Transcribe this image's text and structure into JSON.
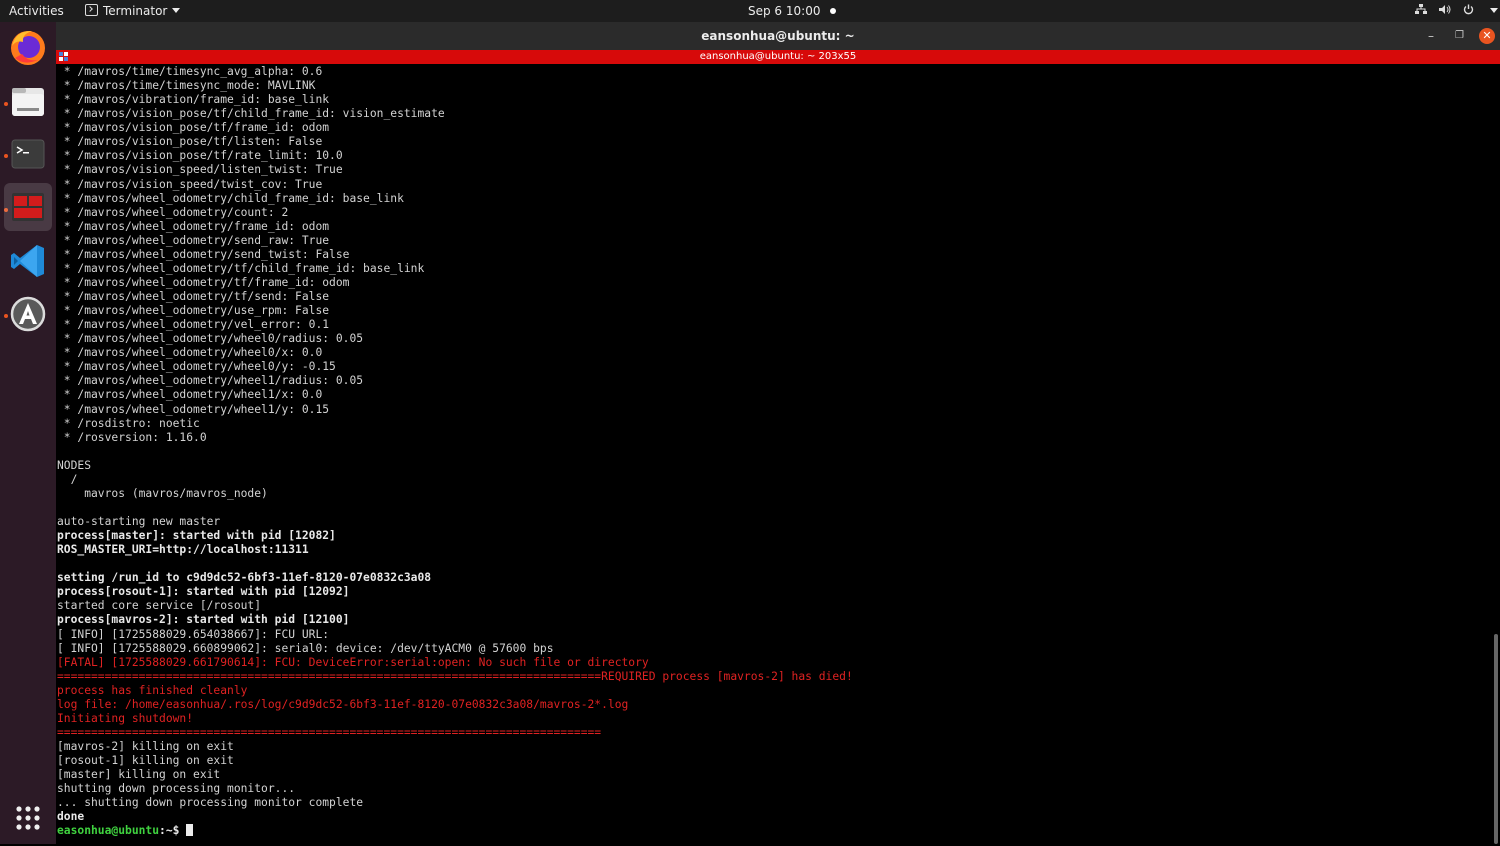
{
  "topbar": {
    "activities": "Activities",
    "app_name": "Terminator",
    "clock": "Sep 6  10:00"
  },
  "dock": {
    "items": [
      {
        "name": "firefox-icon"
      },
      {
        "name": "files-icon"
      },
      {
        "name": "terminal-icon"
      },
      {
        "name": "terminator-icon"
      },
      {
        "name": "vscode-icon"
      },
      {
        "name": "software-center-icon"
      },
      {
        "name": "show-apps-icon"
      }
    ]
  },
  "window": {
    "title": "eansonhua@ubuntu: ~",
    "terminal_title": "eansonhua@ubuntu: ~ 203x55"
  },
  "terminal": {
    "lines": [
      {
        "text": " * /mavros/time/timesync_avg_alpha: 0.6"
      },
      {
        "text": " * /mavros/time/timesync_mode: MAVLINK"
      },
      {
        "text": " * /mavros/vibration/frame_id: base_link"
      },
      {
        "text": " * /mavros/vision_pose/tf/child_frame_id: vision_estimate"
      },
      {
        "text": " * /mavros/vision_pose/tf/frame_id: odom"
      },
      {
        "text": " * /mavros/vision_pose/tf/listen: False"
      },
      {
        "text": " * /mavros/vision_pose/tf/rate_limit: 10.0"
      },
      {
        "text": " * /mavros/vision_speed/listen_twist: True"
      },
      {
        "text": " * /mavros/vision_speed/twist_cov: True"
      },
      {
        "text": " * /mavros/wheel_odometry/child_frame_id: base_link"
      },
      {
        "text": " * /mavros/wheel_odometry/count: 2"
      },
      {
        "text": " * /mavros/wheel_odometry/frame_id: odom"
      },
      {
        "text": " * /mavros/wheel_odometry/send_raw: True"
      },
      {
        "text": " * /mavros/wheel_odometry/send_twist: False"
      },
      {
        "text": " * /mavros/wheel_odometry/tf/child_frame_id: base_link"
      },
      {
        "text": " * /mavros/wheel_odometry/tf/frame_id: odom"
      },
      {
        "text": " * /mavros/wheel_odometry/tf/send: False"
      },
      {
        "text": " * /mavros/wheel_odometry/use_rpm: False"
      },
      {
        "text": " * /mavros/wheel_odometry/vel_error: 0.1"
      },
      {
        "text": " * /mavros/wheel_odometry/wheel0/radius: 0.05"
      },
      {
        "text": " * /mavros/wheel_odometry/wheel0/x: 0.0"
      },
      {
        "text": " * /mavros/wheel_odometry/wheel0/y: -0.15"
      },
      {
        "text": " * /mavros/wheel_odometry/wheel1/radius: 0.05"
      },
      {
        "text": " * /mavros/wheel_odometry/wheel1/x: 0.0"
      },
      {
        "text": " * /mavros/wheel_odometry/wheel1/y: 0.15"
      },
      {
        "text": " * /rosdistro: noetic"
      },
      {
        "text": " * /rosversion: 1.16.0"
      },
      {
        "text": ""
      },
      {
        "text": "NODES"
      },
      {
        "text": "  /"
      },
      {
        "text": "    mavros (mavros/mavros_node)"
      },
      {
        "text": ""
      },
      {
        "text": "auto-starting new master"
      },
      {
        "text": "process[master]: started with pid [12082]",
        "style": "bold"
      },
      {
        "text": "ROS_MASTER_URI=http://localhost:11311",
        "style": "bold"
      },
      {
        "text": ""
      },
      {
        "text": "setting /run_id to c9d9dc52-6bf3-11ef-8120-07e0832c3a08",
        "style": "bold"
      },
      {
        "text": "process[rosout-1]: started with pid [12092]",
        "style": "bold"
      },
      {
        "text": "started core service [/rosout]"
      },
      {
        "text": "process[mavros-2]: started with pid [12100]",
        "style": "bold"
      },
      {
        "text": "[ INFO] [1725588029.654038667]: FCU URL:"
      },
      {
        "text": "[ INFO] [1725588029.660899062]: serial0: device: /dev/ttyACM0 @ 57600 bps"
      },
      {
        "text": "[FATAL] [1725588029.661790614]: FCU: DeviceError:serial:open: No such file or directory",
        "style": "red"
      },
      {
        "text": "================================================================================REQUIRED process [mavros-2] has died!",
        "style": "red"
      },
      {
        "text": "process has finished cleanly",
        "style": "red"
      },
      {
        "text": "log file: /home/easonhua/.ros/log/c9d9dc52-6bf3-11ef-8120-07e0832c3a08/mavros-2*.log",
        "style": "red"
      },
      {
        "text": "Initiating shutdown!",
        "style": "red"
      },
      {
        "text": "================================================================================",
        "style": "red"
      },
      {
        "text": "[mavros-2] killing on exit"
      },
      {
        "text": "[rosout-1] killing on exit"
      },
      {
        "text": "[master] killing on exit"
      },
      {
        "text": "shutting down processing monitor..."
      },
      {
        "text": "... shutting down processing monitor complete"
      },
      {
        "text": "done",
        "style": "bold"
      }
    ],
    "prompt_user": "easonhua@ubuntu",
    "prompt_path": ":~$ "
  }
}
